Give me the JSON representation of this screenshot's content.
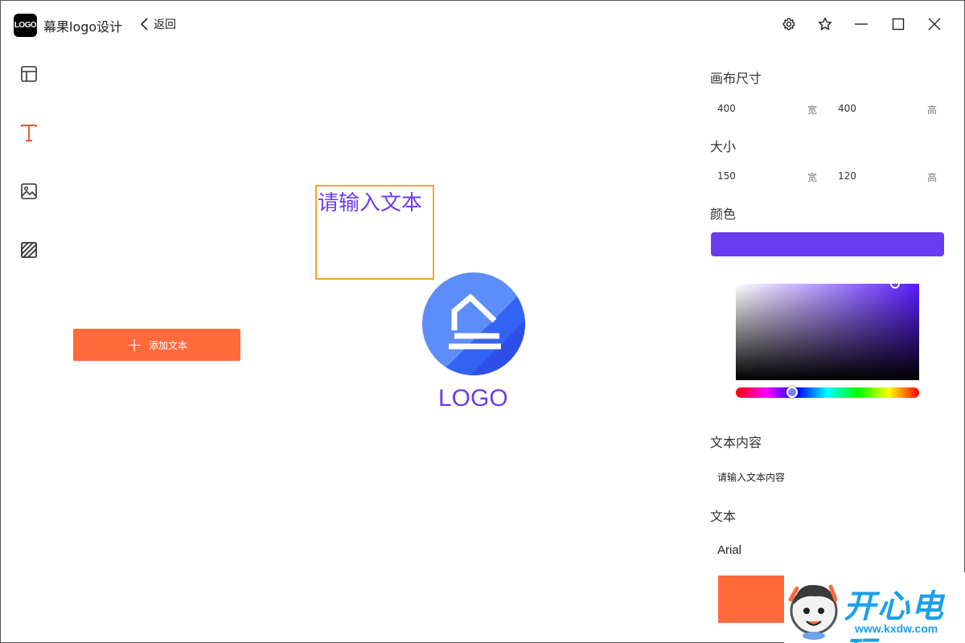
{
  "app": {
    "logo_text": "LOGO",
    "title": "幕果logo设计",
    "back_label": "返回"
  },
  "titlebar_icons": [
    "gear-icon",
    "star-icon",
    "minimize-icon",
    "maximize-icon",
    "close-icon"
  ],
  "rail": {
    "items": [
      {
        "name": "template",
        "icon": "layout-icon",
        "active": false
      },
      {
        "name": "text",
        "icon": "text-icon",
        "active": true
      },
      {
        "name": "image",
        "icon": "image-icon",
        "active": false
      },
      {
        "name": "background",
        "icon": "hatch-icon",
        "active": false
      }
    ]
  },
  "add_text_button": {
    "icon": "plus-icon",
    "label": "添加文本"
  },
  "canvas": {
    "text_placeholder": "请输入文本",
    "logo_icon": "house-icon",
    "logo_text": "LOGO",
    "logo_color": "#6a3cf0",
    "circle_color": "#3b6cf6"
  },
  "panel": {
    "canvas_size": {
      "heading": "画布尺寸",
      "width": "400",
      "width_unit": "宽",
      "height": "400",
      "height_unit": "高"
    },
    "size": {
      "heading": "大小",
      "width": "150",
      "width_unit": "宽",
      "height": "120",
      "height_unit": "高"
    },
    "color": {
      "heading": "颜色",
      "value": "#6a3cf0",
      "hue_color": "#5a1cff"
    },
    "text_content": {
      "heading": "文本内容",
      "value": "请输入文本内容"
    },
    "font": {
      "heading": "文本",
      "value": "Arial"
    },
    "accent": "#ff6a3d"
  },
  "watermark": {
    "text": "开心电玩",
    "url": "www.kxdw.com"
  }
}
